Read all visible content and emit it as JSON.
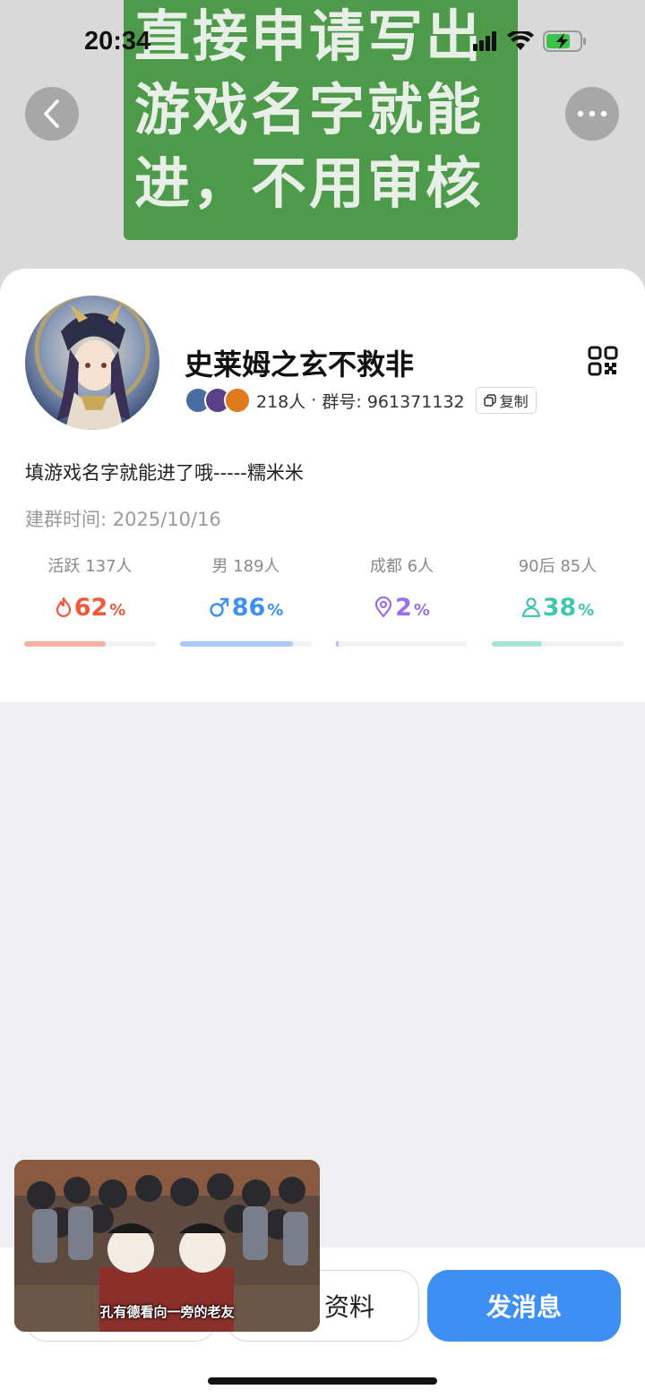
{
  "status_bar": {
    "time": "20:34"
  },
  "banner": {
    "lines": [
      "直接申请写出",
      "游戏名字就能",
      "进，不用审核"
    ]
  },
  "header": {
    "back_icon": "chevron-left-icon",
    "more_icon": "ellipsis-icon"
  },
  "group": {
    "name": "史莱姆之玄不救非",
    "member_count": "218人",
    "separator": " · ",
    "id_label": "群号: 961371132",
    "copy_label": "复制",
    "description": "填游戏名字就能进了哦-----糯米米",
    "created": "建群时间: 2025/10/16"
  },
  "stats": [
    {
      "label": "活跃",
      "count": "137人",
      "value": "62",
      "unit": "%",
      "color": "#ee5a3a",
      "bar_color": "#f3b1a4",
      "fraction": 0.62,
      "icon": "flame-icon"
    },
    {
      "label": "男",
      "count": "189人",
      "value": "86",
      "unit": "%",
      "color": "#3d8ff4",
      "bar_color": "#a9c9f7",
      "fraction": 0.86,
      "icon": "male-icon"
    },
    {
      "label": "成都",
      "count": "6人",
      "value": "2",
      "unit": "%",
      "color": "#9a6fe8",
      "bar_color": "#c7b3f3",
      "fraction": 0.02,
      "icon": "location-pin-icon"
    },
    {
      "label": "90后",
      "count": "85人",
      "value": "38",
      "unit": "%",
      "color": "#3fc7b2",
      "bar_color": "#a4e4d9",
      "fraction": 0.38,
      "icon": "person-icon"
    }
  ],
  "bottom": {
    "profile_button": "资料",
    "send_button": "发消息"
  },
  "pip": {
    "subtitle": "孔有德看向一旁的老友"
  }
}
